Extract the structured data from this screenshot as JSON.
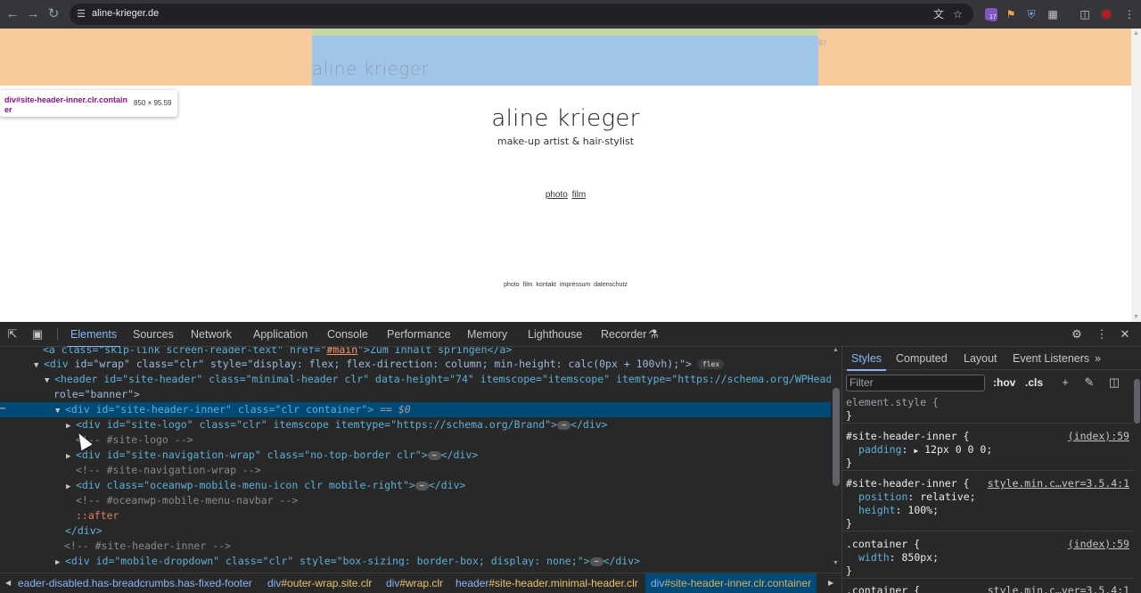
{
  "browser": {
    "url": "aline-krieger.de",
    "ext_badge_count": "17"
  },
  "page": {
    "highlight_logo_text": "aline krieger",
    "highlight_number": "97",
    "tooltip_selector": "div#site-header-inner.clr.container",
    "tooltip_dimensions": "850 × 95.59",
    "site_title": "aline krieger",
    "site_tagline": "make-up artist & hair-stylist",
    "nav_links": [
      "photo",
      "film"
    ],
    "footer_links": [
      "photo",
      "film",
      "kontakt",
      "impressum",
      "datenschutz"
    ]
  },
  "devtools": {
    "tabs": [
      "Elements",
      "Sources",
      "Network",
      "Application",
      "Console",
      "Performance",
      "Memory",
      "Lighthouse",
      "Recorder"
    ],
    "active_tab": "Elements",
    "dom_lines": {
      "l0_a": "<a class=\"skip-link screen-reader-text\" href=\"",
      "l0_href": "#main",
      "l0_b": "\">Zum Inhalt springen</a>",
      "wrap_tag_open": "<div ",
      "wrap_attrs": "id=\"wrap\" class=\"clr\" style=\"display: flex; flex-direction: column; min-height: calc(0px + 100vh);\">",
      "flex_pill": "flex",
      "header_line1": "<header id=\"site-header\" class=\"minimal-header clr\" data-height=\"74\" itemscope=\"itemscope\" itemtype=\"https://schema.org/WPHeader\"",
      "header_line2": "role=\"banner\">",
      "selected_line": "<div id=\"site-header-inner\" class=\"clr container\">",
      "selected_eq": " == $0",
      "logo_line": "<div id=\"site-logo\" class=\"clr\" itemscope itemtype=\"https://schema.org/Brand\">",
      "logo_close": "</div>",
      "cmt_logo": "<!-- #site-logo -->",
      "navwrap_line": "<div id=\"site-navigation-wrap\" class=\"no-top-border clr\">",
      "navwrap_close": "</div>",
      "cmt_navwrap": "<!-- #site-navigation-wrap -->",
      "mobile_line": "<div class=\"oceanwp-mobile-menu-icon clr mobile-right\">",
      "mobile_close": "</div>",
      "cmt_mobile": "<!-- #oceanwp-mobile-menu-navbar -->",
      "after": "::after",
      "close_div": "</div>",
      "cmt_inner": "<!-- #site-header-inner -->",
      "dropdown_line": "<div id=\"mobile-dropdown\" class=\"clr\" style=\"box-sizing: border-box; display: none;\">",
      "dropdown_close": "</div>"
    },
    "breadcrumbs": [
      {
        "tag": "eader-disabled.has-breadcrumbs.has-fixed-footer",
        "cls": ""
      },
      {
        "tag": "div",
        "cls": "#outer-wrap.site.clr"
      },
      {
        "tag": "div",
        "cls": "#wrap.clr"
      },
      {
        "tag": "header",
        "cls": "#site-header.minimal-header.clr"
      },
      {
        "tag": "div",
        "cls": "#site-header-inner.clr.container"
      }
    ],
    "styles_tabs": [
      "Styles",
      "Computed",
      "Layout",
      "Event Listeners"
    ],
    "filter_placeholder": "Filter",
    "hov": ":hov",
    "cls": ".cls",
    "rules": {
      "r1_sel": "element.style {",
      "r1_close": "}",
      "r2_sel": "#site-header-inner {",
      "r2_src": "(index):59",
      "r2_prop": "padding",
      "r2_val": "12px 0 0 0;",
      "r2_close": "}",
      "r3_sel": "#site-header-inner {",
      "r3_src": "style.min.c…ver=3.5.4:1",
      "r3_prop1": "position",
      "r3_val1": "relative;",
      "r3_prop2": "height",
      "r3_val2": "100%;",
      "r3_close": "}",
      "r4_sel": ".container {",
      "r4_src": "(index):59",
      "r4_prop": "width",
      "r4_val": "850px;",
      "r4_close": "}",
      "r5_sel": ".container {",
      "r5_src": "style.min.c…ver=3.5.4:1"
    }
  }
}
